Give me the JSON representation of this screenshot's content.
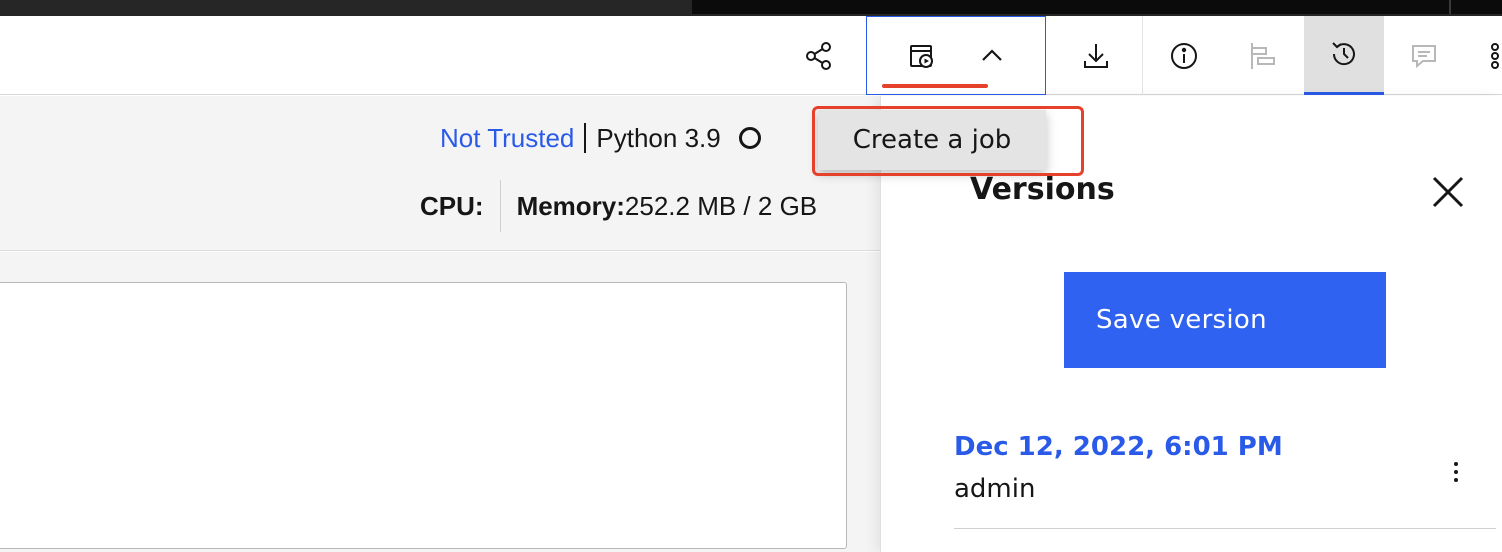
{
  "toolbar": {
    "icons": [
      "share-icon",
      "job-schedule-icon",
      "chevron-up-icon",
      "download-icon",
      "info-icon",
      "timeline-icon",
      "history-icon",
      "comment-icon",
      "more-icon"
    ],
    "accent_color": "#2a5ae8",
    "highlight_color": "#e5412b"
  },
  "kernel": {
    "trust_status": "Not Trusted",
    "language": "Python 3.9"
  },
  "resources": {
    "cpu_label": "CPU:",
    "memory_label": "Memory:",
    "memory_value": "252.2 MB / 2 GB"
  },
  "job_menu": {
    "items": [
      {
        "label": "Create a job"
      }
    ]
  },
  "versions_panel": {
    "title": "Versions",
    "save_button": "Save version",
    "versions": [
      {
        "date": "Dec 12, 2022, 6:01 PM",
        "author": "admin"
      }
    ]
  }
}
